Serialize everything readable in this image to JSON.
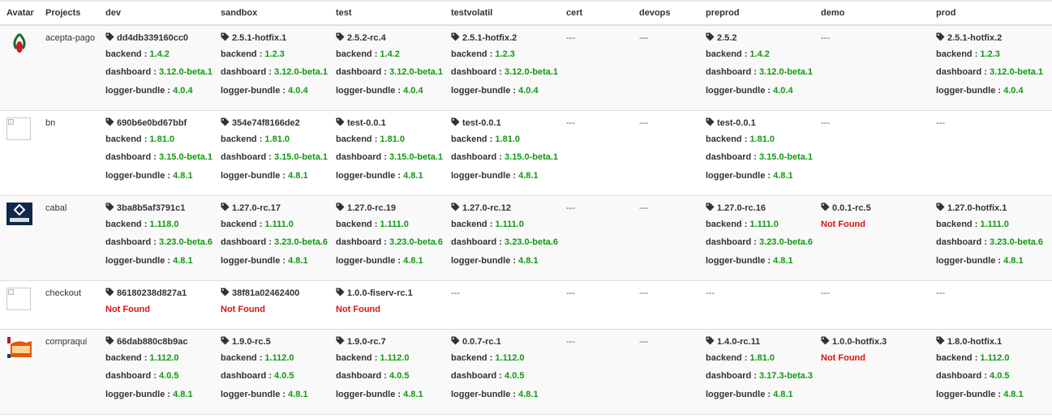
{
  "headers": [
    "Avatar",
    "Projects",
    "dev",
    "sandbox",
    "test",
    "testvolatil",
    "cert",
    "devops",
    "preprod",
    "demo",
    "prod"
  ],
  "colors": {
    "version": "#119911",
    "not_found": "#dd1111",
    "border": "#dddddd",
    "stripe": "#f9f9f9"
  },
  "rows": [
    {
      "project": "acepta-pago",
      "avatar": "acepta-pago-logo",
      "envs": [
        {
          "tag": "dd4db339160cc0",
          "items": [
            {
              "k": "backend",
              "v": "1.4.2"
            },
            {
              "k": "dashboard",
              "v": "3.12.0-beta.1"
            },
            {
              "k": "logger-bundle",
              "v": "4.0.4"
            }
          ]
        },
        {
          "tag": "2.5.1-hotfix.1",
          "items": [
            {
              "k": "backend",
              "v": "1.2.3"
            },
            {
              "k": "dashboard",
              "v": "3.12.0-beta.1"
            },
            {
              "k": "logger-bundle",
              "v": "4.0.4"
            }
          ]
        },
        {
          "tag": "2.5.2-rc.4",
          "items": [
            {
              "k": "backend",
              "v": "1.4.2"
            },
            {
              "k": "dashboard",
              "v": "3.12.0-beta.1"
            },
            {
              "k": "logger-bundle",
              "v": "4.0.4"
            }
          ]
        },
        {
          "tag": "2.5.1-hotfix.2",
          "items": [
            {
              "k": "backend",
              "v": "1.2.3"
            },
            {
              "k": "dashboard",
              "v": "3.12.0-beta.1"
            },
            {
              "k": "logger-bundle",
              "v": "4.0.4"
            }
          ]
        },
        {
          "empty": "---"
        },
        {
          "empty": "---"
        },
        {
          "tag": "2.5.2",
          "items": [
            {
              "k": "backend",
              "v": "1.4.2"
            },
            {
              "k": "dashboard",
              "v": "3.12.0-beta.1"
            },
            {
              "k": "logger-bundle",
              "v": "4.0.4"
            }
          ]
        },
        {
          "empty": "---"
        },
        {
          "tag": "2.5.1-hotfix.2",
          "items": [
            {
              "k": "backend",
              "v": "1.2.3"
            },
            {
              "k": "dashboard",
              "v": "3.12.0-beta.1"
            },
            {
              "k": "logger-bundle",
              "v": "4.0.4"
            }
          ]
        }
      ]
    },
    {
      "project": "bn",
      "avatar": "broken-image",
      "envs": [
        {
          "tag": "690b6e0bd67bbf",
          "items": [
            {
              "k": "backend",
              "v": "1.81.0"
            },
            {
              "k": "dashboard",
              "v": "3.15.0-beta.1"
            },
            {
              "k": "logger-bundle",
              "v": "4.8.1"
            }
          ]
        },
        {
          "tag": "354e74f8166de2",
          "items": [
            {
              "k": "backend",
              "v": "1.81.0"
            },
            {
              "k": "dashboard",
              "v": "3.15.0-beta.1"
            },
            {
              "k": "logger-bundle",
              "v": "4.8.1"
            }
          ]
        },
        {
          "tag": "test-0.0.1",
          "items": [
            {
              "k": "backend",
              "v": "1.81.0"
            },
            {
              "k": "dashboard",
              "v": "3.15.0-beta.1"
            },
            {
              "k": "logger-bundle",
              "v": "4.8.1"
            }
          ]
        },
        {
          "tag": "test-0.0.1",
          "items": [
            {
              "k": "backend",
              "v": "1.81.0"
            },
            {
              "k": "dashboard",
              "v": "3.15.0-beta.1"
            },
            {
              "k": "logger-bundle",
              "v": "4.8.1"
            }
          ]
        },
        {
          "empty": "---"
        },
        {
          "empty": "---"
        },
        {
          "tag": "test-0.0.1",
          "items": [
            {
              "k": "backend",
              "v": "1.81.0"
            },
            {
              "k": "dashboard",
              "v": "3.15.0-beta.1"
            },
            {
              "k": "logger-bundle",
              "v": "4.8.1"
            }
          ]
        },
        {
          "empty": "---"
        },
        {
          "empty": "---"
        }
      ]
    },
    {
      "project": "cabal",
      "avatar": "cabal-logo",
      "envs": [
        {
          "tag": "3ba8b5af3791c1",
          "items": [
            {
              "k": "backend",
              "v": "1.118.0"
            },
            {
              "k": "dashboard",
              "v": "3.23.0-beta.6"
            },
            {
              "k": "logger-bundle",
              "v": "4.8.1"
            }
          ]
        },
        {
          "tag": "1.27.0-rc.17",
          "items": [
            {
              "k": "backend",
              "v": "1.111.0"
            },
            {
              "k": "dashboard",
              "v": "3.23.0-beta.6"
            },
            {
              "k": "logger-bundle",
              "v": "4.8.1"
            }
          ]
        },
        {
          "tag": "1.27.0-rc.19",
          "items": [
            {
              "k": "backend",
              "v": "1.111.0"
            },
            {
              "k": "dashboard",
              "v": "3.23.0-beta.6"
            },
            {
              "k": "logger-bundle",
              "v": "4.8.1"
            }
          ]
        },
        {
          "tag": "1.27.0-rc.12",
          "items": [
            {
              "k": "backend",
              "v": "1.111.0"
            },
            {
              "k": "dashboard",
              "v": "3.23.0-beta.6"
            },
            {
              "k": "logger-bundle",
              "v": "4.8.1"
            }
          ]
        },
        {
          "empty": "---"
        },
        {
          "empty": "---"
        },
        {
          "tag": "1.27.0-rc.16",
          "items": [
            {
              "k": "backend",
              "v": "1.111.0"
            },
            {
              "k": "dashboard",
              "v": "3.23.0-beta.6"
            },
            {
              "k": "logger-bundle",
              "v": "4.8.1"
            }
          ]
        },
        {
          "tag": "0.0.1-rc.5",
          "notfound": "Not Found"
        },
        {
          "tag": "1.27.0-hotfix.1",
          "items": [
            {
              "k": "backend",
              "v": "1.111.0"
            },
            {
              "k": "dashboard",
              "v": "3.23.0-beta.6"
            },
            {
              "k": "logger-bundle",
              "v": "4.8.1"
            }
          ]
        }
      ]
    },
    {
      "project": "checkout",
      "avatar": "broken-image",
      "envs": [
        {
          "tag": "86180238d827a1",
          "notfound": "Not Found"
        },
        {
          "tag": "38f81a02462400",
          "notfound": "Not Found"
        },
        {
          "tag": "1.0.0-fiserv-rc.1",
          "notfound": "Not Found"
        },
        {
          "empty": "---"
        },
        {
          "empty": "---"
        },
        {
          "empty": "---"
        },
        {
          "empty": "---"
        },
        {
          "empty": "---"
        },
        {
          "empty": "---"
        }
      ]
    },
    {
      "project": "compraqui",
      "avatar": "compraqui-logo",
      "envs": [
        {
          "tag": "66dab880c8b9ac",
          "items": [
            {
              "k": "backend",
              "v": "1.112.0"
            },
            {
              "k": "dashboard",
              "v": "4.0.5"
            },
            {
              "k": "logger-bundle",
              "v": "4.8.1"
            }
          ]
        },
        {
          "tag": "1.9.0-rc.5",
          "items": [
            {
              "k": "backend",
              "v": "1.112.0"
            },
            {
              "k": "dashboard",
              "v": "4.0.5"
            },
            {
              "k": "logger-bundle",
              "v": "4.8.1"
            }
          ]
        },
        {
          "tag": "1.9.0-rc.7",
          "items": [
            {
              "k": "backend",
              "v": "1.112.0"
            },
            {
              "k": "dashboard",
              "v": "4.0.5"
            },
            {
              "k": "logger-bundle",
              "v": "4.8.1"
            }
          ]
        },
        {
          "tag": "0.0.7-rc.1",
          "items": [
            {
              "k": "backend",
              "v": "1.112.0"
            },
            {
              "k": "dashboard",
              "v": "4.0.5"
            },
            {
              "k": "logger-bundle",
              "v": "4.8.1"
            }
          ]
        },
        {
          "empty": "---"
        },
        {
          "empty": "---"
        },
        {
          "tag": "1.4.0-rc.11",
          "items": [
            {
              "k": "backend",
              "v": "1.81.0"
            },
            {
              "k": "dashboard",
              "v": "3.17.3-beta.3"
            },
            {
              "k": "logger-bundle",
              "v": "4.8.1"
            }
          ]
        },
        {
          "tag": "1.0.0-hotfix.3",
          "notfound": "Not Found"
        },
        {
          "tag": "1.8.0-hotfix.1",
          "items": [
            {
              "k": "backend",
              "v": "1.112.0"
            },
            {
              "k": "dashboard",
              "v": "4.0.5"
            },
            {
              "k": "logger-bundle",
              "v": "4.8.1"
            }
          ]
        }
      ]
    }
  ]
}
